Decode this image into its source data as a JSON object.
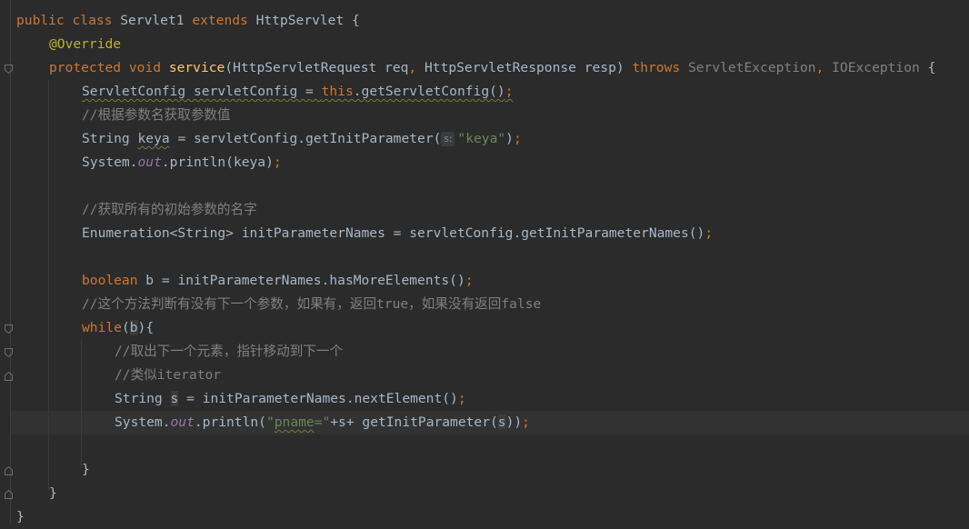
{
  "editor": {
    "lines": [
      {
        "name": "line-class-decl",
        "indent": 0,
        "tokens": [
          {
            "t": "public ",
            "c": "kw"
          },
          {
            "t": "class ",
            "c": "kw"
          },
          {
            "t": "Servlet1 "
          },
          {
            "t": "extends ",
            "c": "kw"
          },
          {
            "t": "HttpServlet {"
          }
        ]
      },
      {
        "name": "line-override",
        "indent": 1,
        "tokens": [
          {
            "t": "@Override",
            "c": "ann"
          }
        ]
      },
      {
        "name": "line-method-decl",
        "indent": 1,
        "tokens": [
          {
            "t": "protected ",
            "c": "kw"
          },
          {
            "t": "void ",
            "c": "kw"
          },
          {
            "t": "service",
            "c": "fn"
          },
          {
            "t": "(HttpServletRequest req"
          },
          {
            "t": ", ",
            "c": "kw"
          },
          {
            "t": "HttpServletResponse resp) "
          },
          {
            "t": "throws ",
            "c": "kw"
          },
          {
            "t": "ServletException",
            "c": "muted"
          },
          {
            "t": ", ",
            "c": "kw"
          },
          {
            "t": "IOException",
            "c": "muted"
          },
          {
            "t": " {"
          }
        ]
      },
      {
        "name": "line-servletconfig",
        "indent": 2,
        "tokens": [
          {
            "t": "ServletConfig servletConfig = ",
            "c": "sqg"
          },
          {
            "t": "this",
            "c": "kw sqg"
          },
          {
            "t": ".getServletConfig()",
            "c": "sqg"
          },
          {
            "t": ";",
            "c": "kw sqg"
          }
        ]
      },
      {
        "name": "line-comment-1",
        "indent": 2,
        "tokens": [
          {
            "t": "//根据参数名获取参数值",
            "c": "cmt"
          }
        ]
      },
      {
        "name": "line-string-keya",
        "indent": 2,
        "tokens": [
          {
            "t": "String "
          },
          {
            "t": "keya",
            "c": "sqg"
          },
          {
            "t": " = servletConfig.getInitParameter("
          },
          {
            "t": "s:",
            "c": "hint"
          },
          {
            "t": "\"keya\"",
            "c": "str"
          },
          {
            "t": ")"
          },
          {
            "t": ";",
            "c": "kw"
          }
        ]
      },
      {
        "name": "line-println-keya",
        "indent": 2,
        "tokens": [
          {
            "t": "System."
          },
          {
            "t": "out",
            "c": "st"
          },
          {
            "t": ".println(keya)"
          },
          {
            "t": ";",
            "c": "kw"
          }
        ]
      },
      {
        "name": "line-blank-1",
        "indent": 2,
        "tokens": []
      },
      {
        "name": "line-comment-2",
        "indent": 2,
        "tokens": [
          {
            "t": "//获取所有的初始参数的名字",
            "c": "cmt"
          }
        ]
      },
      {
        "name": "line-enumeration",
        "indent": 2,
        "tokens": [
          {
            "t": "Enumeration<String> initParameterNames = servletConfig.getInitParameterNames()"
          },
          {
            "t": ";",
            "c": "kw"
          }
        ]
      },
      {
        "name": "line-blank-2",
        "indent": 2,
        "tokens": []
      },
      {
        "name": "line-boolean",
        "indent": 2,
        "tokens": [
          {
            "t": "boolean ",
            "c": "kw"
          },
          {
            "t": "b = initParameterNames.hasMoreElements()"
          },
          {
            "t": ";",
            "c": "kw"
          }
        ]
      },
      {
        "name": "line-comment-3",
        "indent": 2,
        "tokens": [
          {
            "t": "//这个方法判断有没有下一个参数，如果有，返回true，如果没有返回false",
            "c": "cmt"
          }
        ]
      },
      {
        "name": "line-while",
        "indent": 2,
        "tokens": [
          {
            "t": "while",
            "c": "kw"
          },
          {
            "t": "("
          },
          {
            "t": "b",
            "c": "hlvar"
          },
          {
            "t": "){"
          }
        ]
      },
      {
        "name": "line-comment-4",
        "indent": 3,
        "tokens": [
          {
            "t": "//取出下一个元素，指针移动到下一个",
            "c": "cmt"
          }
        ]
      },
      {
        "name": "line-comment-5",
        "indent": 3,
        "tokens": [
          {
            "t": "//类似iterator",
            "c": "cmt"
          }
        ]
      },
      {
        "name": "line-string-s",
        "indent": 3,
        "tokens": [
          {
            "t": "String "
          },
          {
            "t": "s",
            "c": "hlvar"
          },
          {
            "t": " = initParameterNames.nextElement()"
          },
          {
            "t": ";",
            "c": "kw"
          }
        ]
      },
      {
        "name": "line-println-pname",
        "indent": 3,
        "tokens": [
          {
            "t": "System."
          },
          {
            "t": "out",
            "c": "st"
          },
          {
            "t": ".println("
          },
          {
            "t": "\"",
            "c": "str"
          },
          {
            "t": "pname",
            "c": "str sqg"
          },
          {
            "t": "=\"",
            "c": "str"
          },
          {
            "t": "+s+ getInitParameter("
          },
          {
            "t": "s",
            "c": "hlvar"
          },
          {
            "t": "))"
          },
          {
            "t": ";",
            "c": "kw"
          }
        ]
      },
      {
        "name": "line-blank-3",
        "indent": 3,
        "tokens": []
      },
      {
        "name": "line-close-while",
        "indent": 2,
        "tokens": [
          {
            "t": "}"
          }
        ]
      },
      {
        "name": "line-close-method",
        "indent": 1,
        "tokens": [
          {
            "t": "}"
          }
        ]
      },
      {
        "name": "line-close-class",
        "indent": 0,
        "tokens": [
          {
            "t": "}"
          }
        ]
      }
    ]
  }
}
